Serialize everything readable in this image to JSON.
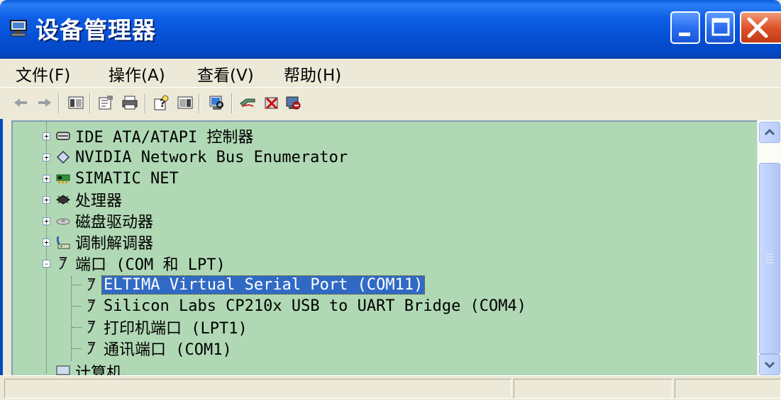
{
  "window": {
    "title": "设备管理器",
    "controls": {
      "minimize": "minimize",
      "maximize": "maximize",
      "close": "close"
    }
  },
  "menu": {
    "items": [
      {
        "label": "文件(F)"
      },
      {
        "label": "操作(A)"
      },
      {
        "label": "查看(V)"
      },
      {
        "label": "帮助(H)"
      }
    ]
  },
  "toolbar": {
    "buttons": [
      "back-icon",
      "forward-icon",
      "show-hide-tree-icon",
      "properties-icon",
      "print-icon",
      "help-icon",
      "view-icon",
      "scan-hardware-icon",
      "update-driver-icon",
      "uninstall-icon",
      "disable-icon"
    ]
  },
  "tree": {
    "items": [
      {
        "label": "IDE ATA/ATAPI 控制器",
        "icon": "ide-controller-icon",
        "expander": "+"
      },
      {
        "label": "NVIDIA Network Bus Enumerator",
        "icon": "network-bus-icon",
        "expander": "+"
      },
      {
        "label": "SIMATIC NET",
        "icon": "simatic-card-icon",
        "expander": "+"
      },
      {
        "label": "处理器",
        "icon": "processor-icon",
        "expander": "+"
      },
      {
        "label": "磁盘驱动器",
        "icon": "disk-drive-icon",
        "expander": "+"
      },
      {
        "label": "调制解调器",
        "icon": "modem-icon",
        "expander": "+"
      },
      {
        "label": "端口 (COM 和 LPT)",
        "icon": "port-icon",
        "expander": "-"
      }
    ],
    "ports": [
      {
        "label": "ELTIMA Virtual Serial Port (COM11)",
        "icon": "port-icon",
        "selected": true
      },
      {
        "label": "Silicon Labs CP210x USB to UART Bridge (COM4)",
        "icon": "port-icon"
      },
      {
        "label": "打印机端口 (LPT1)",
        "icon": "port-icon"
      },
      {
        "label": "通讯端口 (COM1)",
        "icon": "port-icon"
      }
    ],
    "partial": {
      "label": "计算机",
      "icon": "computer-icon"
    }
  },
  "colors": {
    "tree_background": "#b0d8b4",
    "selection": "#316ac5",
    "titlebar": "#0551d6"
  }
}
